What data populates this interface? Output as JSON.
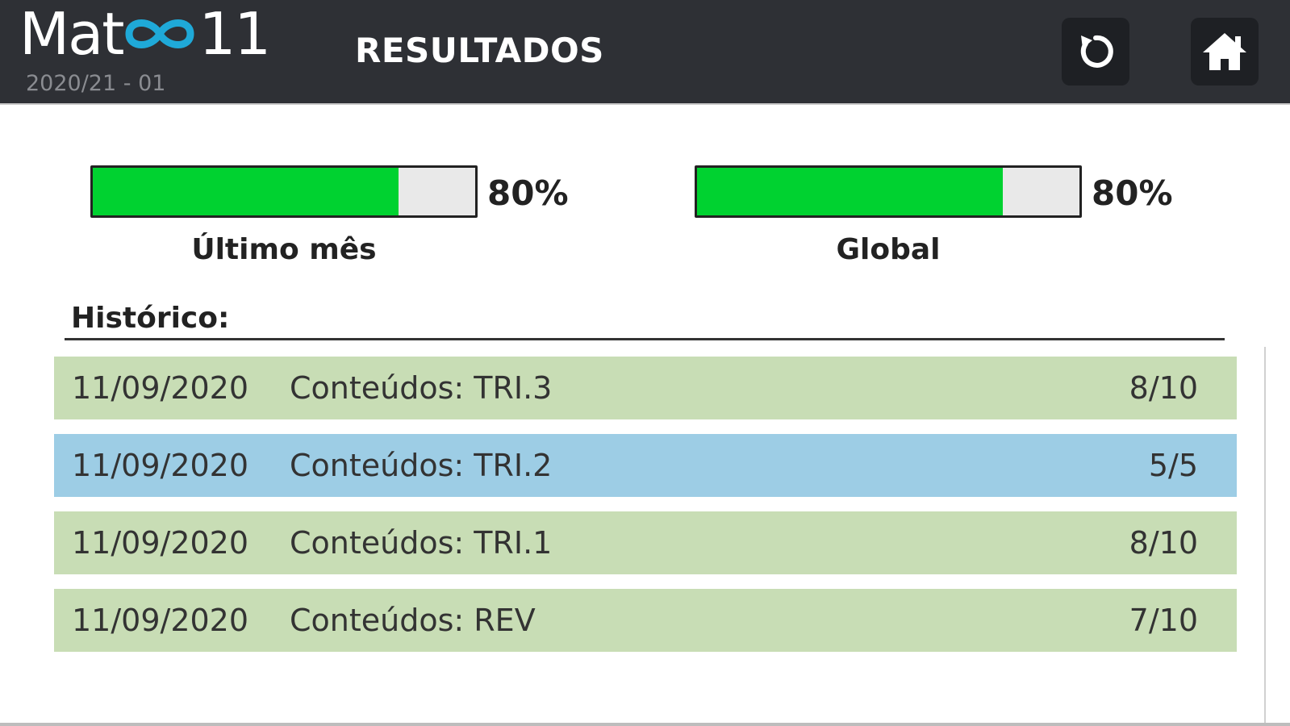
{
  "header": {
    "logo_prefix": "Mat",
    "logo_suffix": "11",
    "year_label": "2020/21 - 01",
    "title": "RESULTADOS",
    "icons": {
      "reset": "reset-icon",
      "home": "home-icon"
    }
  },
  "meters": [
    {
      "label": "Último mês",
      "percent_label": "80%",
      "fraction": 0.8
    },
    {
      "label": "Global",
      "percent_label": "80%",
      "fraction": 0.8
    }
  ],
  "history": {
    "title": "Histórico:",
    "rows": [
      {
        "date": "11/09/2020",
        "content": "Conteúdos: TRI.3",
        "score": "8/10",
        "color": "green"
      },
      {
        "date": "11/09/2020",
        "content": "Conteúdos: TRI.2",
        "score": "5/5",
        "color": "blue"
      },
      {
        "date": "11/09/2020",
        "content": "Conteúdos: TRI.1",
        "score": "8/10",
        "color": "green"
      },
      {
        "date": "11/09/2020",
        "content": "Conteúdos: REV",
        "score": "7/10",
        "color": "green"
      }
    ]
  },
  "colors": {
    "header_bg": "#2e3035",
    "progress_fill": "#00d230",
    "row_green": "#c8ddb5",
    "row_blue": "#9dcde5",
    "logo_accent": "#1fa9d8"
  }
}
